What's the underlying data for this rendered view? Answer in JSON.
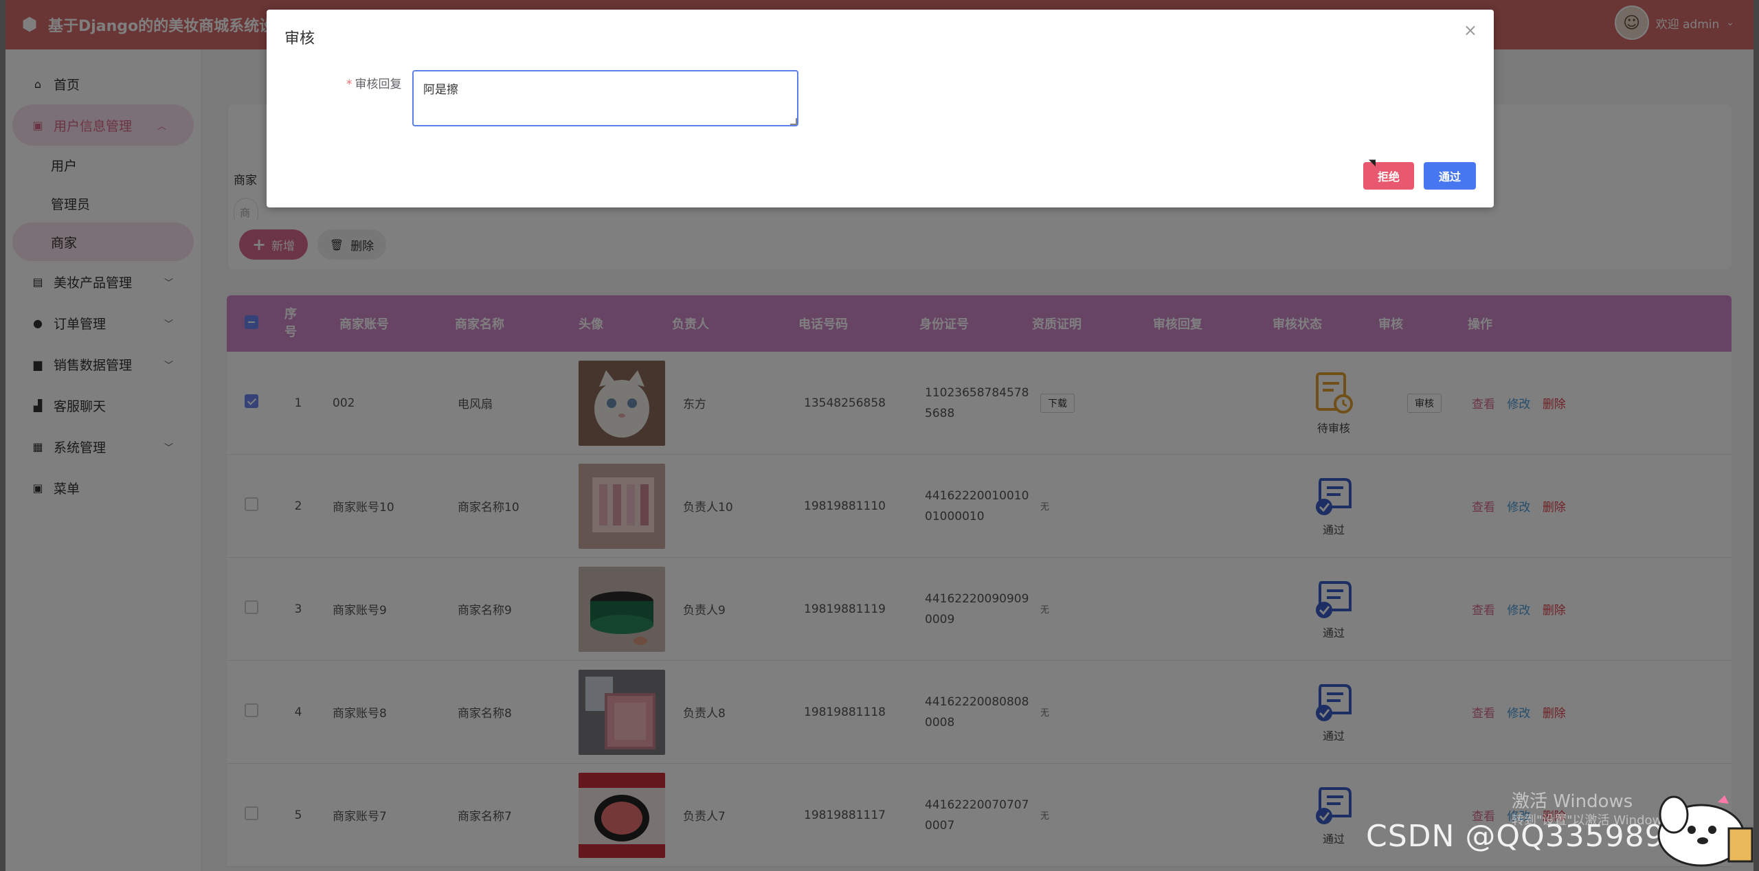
{
  "header": {
    "app_title": "基于Django的的美妆商城系统设",
    "welcome": "欢迎 admin"
  },
  "sidebar": {
    "home": "首页",
    "user_info_group": "用户信息管理",
    "user_sub": [
      "用户",
      "管理员",
      "商家"
    ],
    "product_mgmt": "美妆产品管理",
    "order_mgmt": "订单管理",
    "sales_data": "销售数据管理",
    "chat": "客服聊天",
    "system_mgmt": "系统管理",
    "menu": "菜单"
  },
  "search": {
    "label": "商家",
    "placeholder": "商"
  },
  "toolbar": {
    "add_label": "新增",
    "delete_label": "删除"
  },
  "table": {
    "headers": {
      "idx": "序号",
      "account": "商家账号",
      "name": "商家名称",
      "avatar": "头像",
      "owner": "负责人",
      "phone": "电话号码",
      "id_card": "身份证号",
      "qualification": "资质证明",
      "reply": "审核回复",
      "status": "审核状态",
      "audit": "审核",
      "ops": "操作"
    },
    "rows": [
      {
        "idx": "1",
        "account": "002",
        "name": "电风扇",
        "owner": "东方",
        "phone": "13548256858",
        "id_card": "110236587845785688",
        "qualification": "下载",
        "reply": "",
        "status": "待审核",
        "audit": "审核"
      },
      {
        "idx": "2",
        "account": "商家账号10",
        "name": "商家名称10",
        "owner": "负责人10",
        "phone": "19819881110",
        "id_card": "4416222001001001000010",
        "qualification": "无",
        "reply": "",
        "status": "通过",
        "audit": ""
      },
      {
        "idx": "3",
        "account": "商家账号9",
        "name": "商家名称9",
        "owner": "负责人9",
        "phone": "19819881119",
        "id_card": "441622200909090009",
        "qualification": "无",
        "reply": "",
        "status": "通过",
        "audit": ""
      },
      {
        "idx": "4",
        "account": "商家账号8",
        "name": "商家名称8",
        "owner": "负责人8",
        "phone": "19819881118",
        "id_card": "441622200808080008",
        "qualification": "无",
        "reply": "",
        "status": "通过",
        "audit": ""
      },
      {
        "idx": "5",
        "account": "商家账号7",
        "name": "商家名称7",
        "owner": "负责人7",
        "phone": "19819881117",
        "id_card": "441622200707070007",
        "qualification": "无",
        "reply": "",
        "status": "通过",
        "audit": ""
      }
    ],
    "op_view": "查看",
    "op_edit": "修改",
    "op_delete": "删除"
  },
  "dialog": {
    "title": "审核",
    "field_label": "审核回复",
    "reply_value": "阿是擦",
    "reject_label": "拒绝",
    "pass_label": "通过"
  },
  "watermarks": {
    "windows": "激活 Windows",
    "windows_sub": "转到\"设置\"以激活 Windows。",
    "csdn": "CSDN @QQ3359892174"
  },
  "colors": {
    "header": "#d36a6a",
    "table_header": "#cf86c9",
    "accent_pink": "#d96b8e",
    "pass_blue": "#4677f0",
    "reject_red": "#e8586e"
  }
}
